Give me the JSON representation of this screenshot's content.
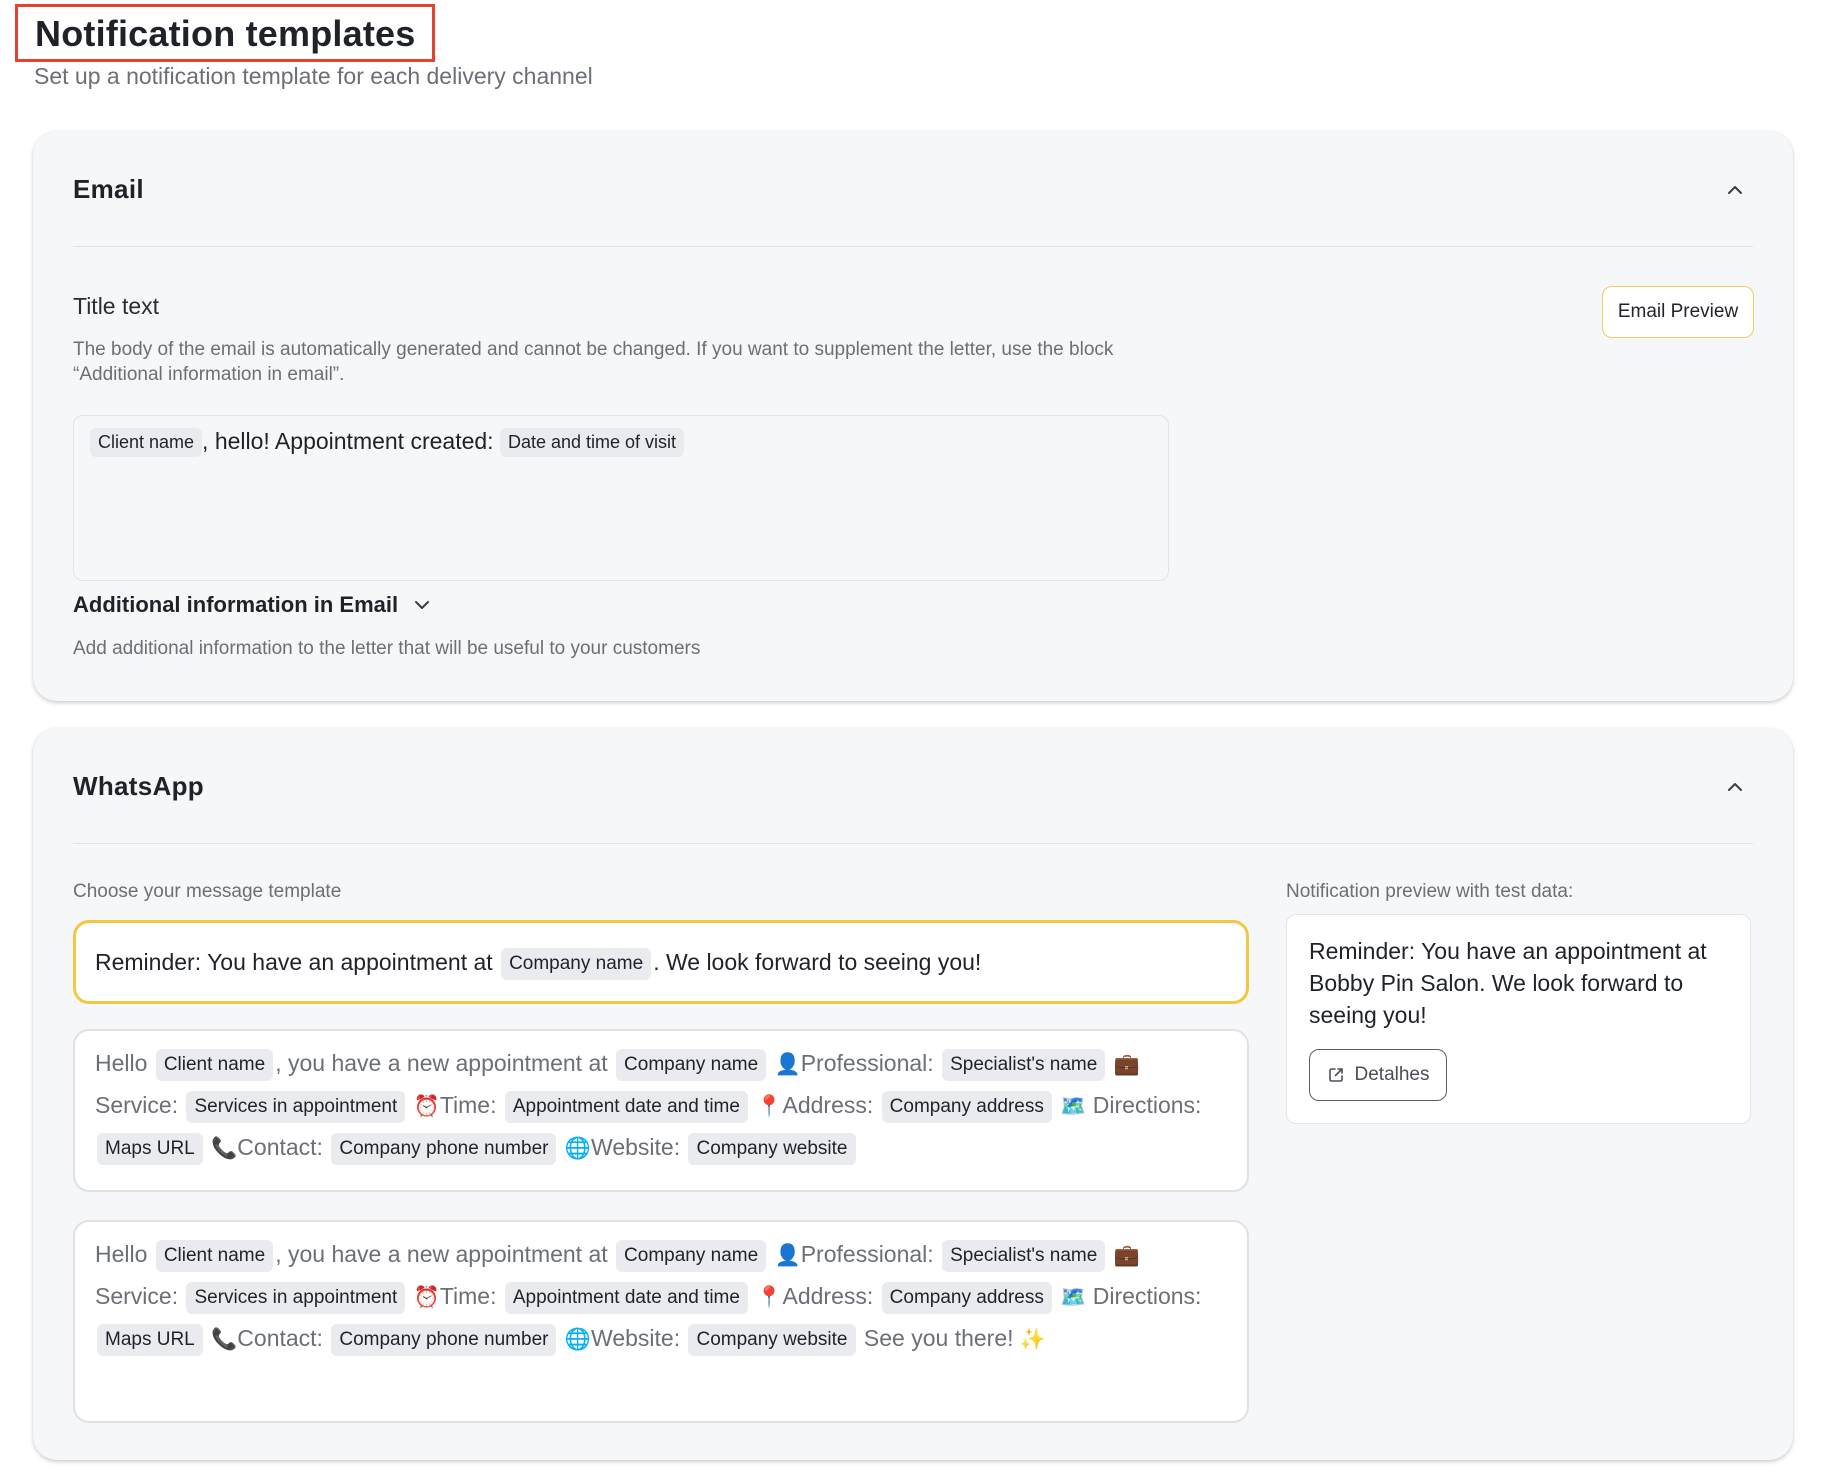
{
  "page": {
    "title": "Notification templates",
    "subtitle": "Set up a notification template for each delivery channel"
  },
  "email": {
    "section_title": "Email",
    "title_label": "Title text",
    "description": "The body of the email is automatically generated and cannot be changed. If you want to supplement the letter, use the block “Additional information in email”.",
    "preview_button": "Email Preview",
    "title_field": {
      "chip_client": "Client name",
      "text": ", hello! Appointment created:",
      "chip_datetime": "Date and time of visit"
    },
    "additional_title": "Additional information in Email",
    "additional_desc": "Add additional information to the letter that will be useful to your customers"
  },
  "whatsapp": {
    "section_title": "WhatsApp",
    "choose_label": "Choose your message template",
    "preview_label": "Notification preview with test data:",
    "template1": {
      "before": "Reminder: You have an appointment at",
      "chip_company": "Company name",
      "after": ". We look forward to seeing you!"
    },
    "template2": {
      "hello": "Hello",
      "chip_client": "Client name",
      "t1": ", you have a new appointment at",
      "chip_company": "Company name",
      "t_professional": "Professional:",
      "chip_specialist": "Specialist's name",
      "t_service": "Service:",
      "chip_services": "Services in appointment",
      "t_time": "Time:",
      "chip_datetime": "Appointment date and time",
      "t_address": "Address:",
      "chip_address": "Company address",
      "t_directions": "Directions:",
      "chip_maps": "Maps URL",
      "t_contact": "Contact:",
      "chip_phone": "Company phone number",
      "t_website": "Website:",
      "chip_website": "Company website"
    },
    "template3": {
      "hello": "Hello",
      "chip_client": "Client name",
      "t1": ", you have a new appointment at",
      "chip_company": "Company name",
      "t_professional": "Professional:",
      "chip_specialist": "Specialist's name",
      "t_service": "Service:",
      "chip_services": "Services in appointment",
      "t_time": "Time:",
      "chip_datetime": "Appointment date and time",
      "t_address": "Address:",
      "chip_address": "Company address",
      "t_directions": "Directions:",
      "chip_maps": "Maps URL",
      "t_contact": "Contact:",
      "chip_phone": "Company phone number",
      "t_website": "Website:",
      "chip_website": "Company website",
      "closing": "See you there!"
    },
    "preview": {
      "text": "Reminder: You have an appointment at Bobby Pin Salon. We look forward to seeing you!",
      "details_button": "Detalhes"
    }
  },
  "icons": {
    "collapse": "chevron-up-icon",
    "expand": "chevron-down-icon",
    "external": "external-link-icon",
    "person": "👤",
    "briefcase": "💼",
    "clock": "⏰",
    "pin": "📍",
    "map": "🗺️",
    "phone": "📞",
    "globe": "🌐",
    "sparkles": "✨"
  },
  "colors": {
    "highlight_border": "#e5432f",
    "selected_border": "#f2c744",
    "preview_button_border": "#f1cd63",
    "card_background": "#f6f7f9"
  }
}
